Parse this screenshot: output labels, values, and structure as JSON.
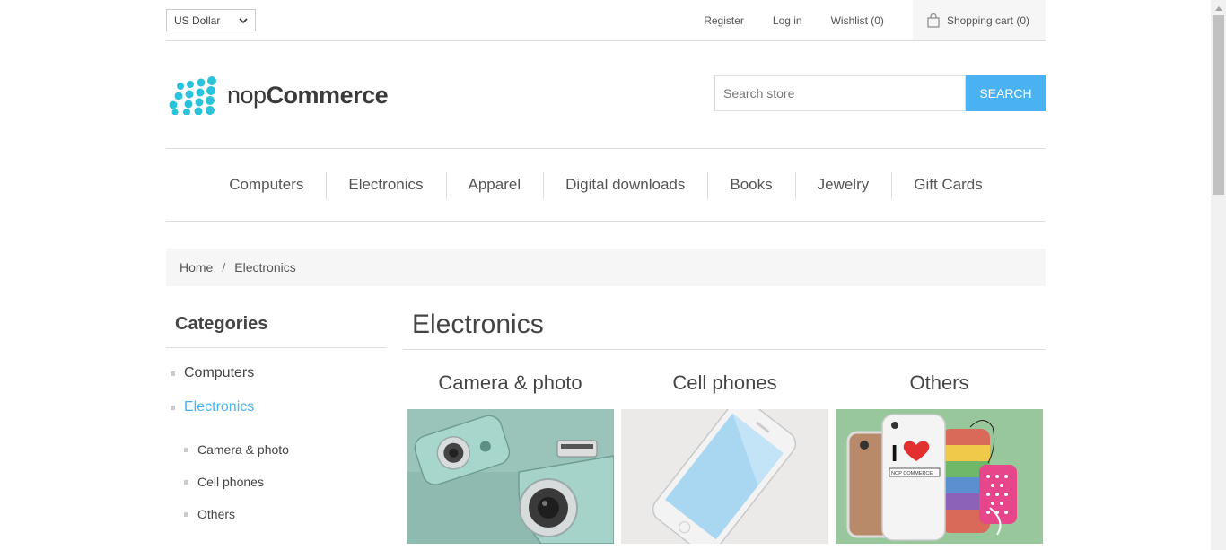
{
  "header": {
    "currency": "US Dollar",
    "links": {
      "register": "Register",
      "login": "Log in",
      "wishlist": "Wishlist (0)",
      "cart": "Shopping cart (0)"
    }
  },
  "logo": {
    "light": "nop",
    "bold": "Commerce"
  },
  "search": {
    "placeholder": "Search store",
    "button": "SEARCH"
  },
  "menu": [
    "Computers",
    "Electronics",
    "Apparel",
    "Digital downloads",
    "Books",
    "Jewelry",
    "Gift Cards"
  ],
  "breadcrumb": {
    "home": "Home",
    "separator": "/",
    "current": "Electronics"
  },
  "sidebar": {
    "title": "Categories",
    "categories": [
      "Computers",
      "Electronics"
    ],
    "subcategories": [
      "Camera & photo",
      "Cell phones",
      "Others"
    ]
  },
  "main": {
    "title": "Electronics",
    "subcategories": [
      {
        "title": "Camera & photo",
        "image": "camera-image"
      },
      {
        "title": "Cell phones",
        "image": "phone-image"
      },
      {
        "title": "Others",
        "image": "phone-cases-image"
      }
    ]
  },
  "colors": {
    "accent": "#4ab2f1",
    "logo": "#2bc3d9",
    "border": "#dddddd",
    "panel": "#f6f6f6"
  }
}
